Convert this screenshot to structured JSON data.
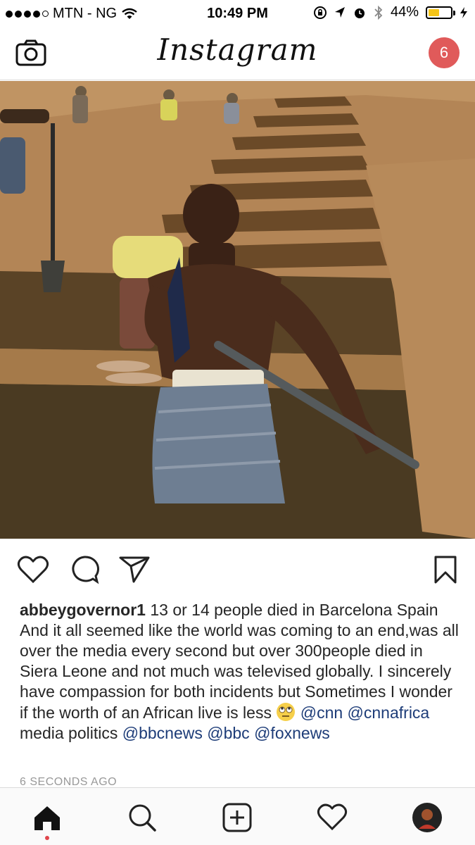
{
  "status_bar": {
    "carrier": "MTN - NG",
    "time": "10:49 PM",
    "battery": "44%",
    "battery_level": 0.44,
    "icons": [
      "signal-dots-icon",
      "wifi-icon",
      "orientation-lock-icon",
      "location-arrow-icon",
      "alarm-icon",
      "bluetooth-icon",
      "battery-icon",
      "charging-bolt-icon"
    ]
  },
  "header": {
    "logo": "Instagram",
    "camera_icon": "camera-icon",
    "notification_count": "6"
  },
  "post": {
    "image_icon": "post-photo",
    "actions": [
      "heart-icon",
      "comment-icon",
      "share-icon",
      "bookmark-icon"
    ],
    "caption": {
      "username": "abbeygovernor1",
      "text_part1": " 13 or 14 people died in Barcelona Spain  And it all seemed like the world was coming to an end,was all over the media every second but over 300people died in Siera Leone and not much was televised globally. I sincerely have compassion for both incidents but Sometimes I wonder if the worth of an African live is less ",
      "emoji": "eye-roll-emoji",
      "mention1": "@cnn",
      "mention2": "@cnnafrica",
      "text_part2": "  media politics ",
      "mention3": "@bbcnews",
      "mention4": "@bbc",
      "mention5": "@foxnews"
    },
    "timestamp": "6 SECONDS AGO"
  },
  "tab_bar": {
    "tabs": [
      "home-icon",
      "search-icon",
      "add-post-icon",
      "activity-heart-icon",
      "profile-avatar"
    ],
    "active": "home-icon",
    "accent": "#e0454b"
  }
}
